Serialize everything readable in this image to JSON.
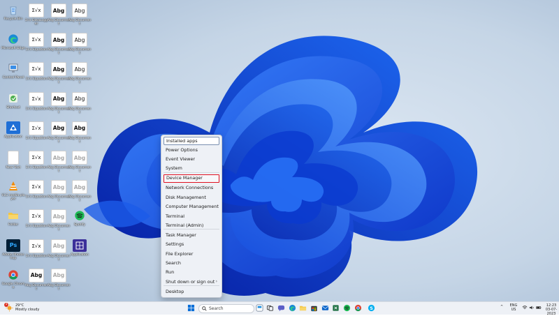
{
  "desktop": {
    "icons": [
      {
        "label": "Recycle Bin",
        "kind": "recycle"
      },
      {
        "label": "Σ√x DataLogger",
        "kind": "sigma"
      },
      {
        "label": "Abg Document",
        "kind": "abg"
      },
      {
        "label": "Abg Document",
        "kind": "abg-plain"
      },
      {
        "label": "Microsoft Edge",
        "kind": "edge"
      },
      {
        "label": "Σ√x Equation",
        "kind": "sigma"
      },
      {
        "label": "Abg Document",
        "kind": "abg"
      },
      {
        "label": "Abg Document",
        "kind": "abg-plain"
      },
      {
        "label": "Control Panel",
        "kind": "pc"
      },
      {
        "label": "Σ√x Equation",
        "kind": "sigma"
      },
      {
        "label": "Abg Document",
        "kind": "abg"
      },
      {
        "label": "Abg Document",
        "kind": "abg-plain"
      },
      {
        "label": "Shortcut",
        "kind": "app-green"
      },
      {
        "label": "Σ√x Equation",
        "kind": "sigma"
      },
      {
        "label": "Abg Document",
        "kind": "abg"
      },
      {
        "label": "Abg Document",
        "kind": "abg-plain"
      },
      {
        "label": "Application",
        "kind": "app-blue"
      },
      {
        "label": "Σ√x Equation",
        "kind": "sigma"
      },
      {
        "label": "Abg Document",
        "kind": "abg"
      },
      {
        "label": "Abg Document",
        "kind": "abg"
      },
      {
        "label": "New Text",
        "kind": "blank"
      },
      {
        "label": "Σ√x Equation",
        "kind": "sigma"
      },
      {
        "label": "Abg Document",
        "kind": "abg-faded"
      },
      {
        "label": "Abg Document",
        "kind": "abg-faded"
      },
      {
        "label": "VLC media player",
        "kind": "vlc"
      },
      {
        "label": "Σ√x Equation",
        "kind": "sigma"
      },
      {
        "label": "Abg Document",
        "kind": "abg-faded"
      },
      {
        "label": "Abg Document",
        "kind": "abg-faded"
      },
      {
        "label": "Folder",
        "kind": "folder"
      },
      {
        "label": "Σ√x Equation",
        "kind": "sigma"
      },
      {
        "label": "Abg Document",
        "kind": "abg-faded"
      },
      {
        "label": "Spotify",
        "kind": "spotify"
      },
      {
        "label": "Adobe Photoshop",
        "kind": "ps"
      },
      {
        "label": "Σ√x Equation",
        "kind": "sigma"
      },
      {
        "label": "Abg Document",
        "kind": "abg-faded"
      },
      {
        "label": "Application",
        "kind": "purple"
      },
      {
        "label": "Google Chrome",
        "kind": "chrome"
      },
      {
        "label": "Abg Document",
        "kind": "abg"
      },
      {
        "label": "Abg Document",
        "kind": "abg-faded"
      }
    ],
    "glyphs": {
      "sigma": "Σ√x",
      "abg": "Abg",
      "ps": "Ps"
    }
  },
  "context_menu": {
    "items": [
      {
        "label": "Installed apps"
      },
      {
        "label": "Power Options"
      },
      {
        "label": "Event Viewer"
      },
      {
        "label": "System"
      },
      {
        "label": "Device Manager"
      },
      {
        "label": "Network Connections"
      },
      {
        "label": "Disk Management"
      },
      {
        "label": "Computer Management"
      },
      {
        "label": "Terminal"
      },
      {
        "label": "Terminal (Admin)"
      },
      {
        "label": "Task Manager"
      },
      {
        "label": "Settings"
      },
      {
        "label": "File Explorer"
      },
      {
        "label": "Search"
      },
      {
        "label": "Run"
      },
      {
        "label": "Shut down or sign out"
      },
      {
        "label": "Desktop"
      }
    ],
    "submenu_arrow": "›",
    "hovered_index": 0,
    "highlighted_index": 4,
    "highlight_color": "#e01020"
  },
  "taskbar": {
    "weather": {
      "temp": "29°C",
      "condition": "Mostly cloudy",
      "badge": "1"
    },
    "search_placeholder": "Search",
    "tray": {
      "chevron": "^",
      "lang_top": "ENG",
      "lang_bottom": "US",
      "time": "12:23",
      "date": "03-07-2023"
    },
    "pinned": [
      "start",
      "search",
      "widgets",
      "chat",
      "edge",
      "explorer",
      "store",
      "mail",
      "spotify",
      "chrome",
      "skype"
    ]
  },
  "colors": {
    "accent": "#0067c0",
    "menu_bg": "#eef1f6",
    "taskbar_bg": "#eef1f6"
  }
}
